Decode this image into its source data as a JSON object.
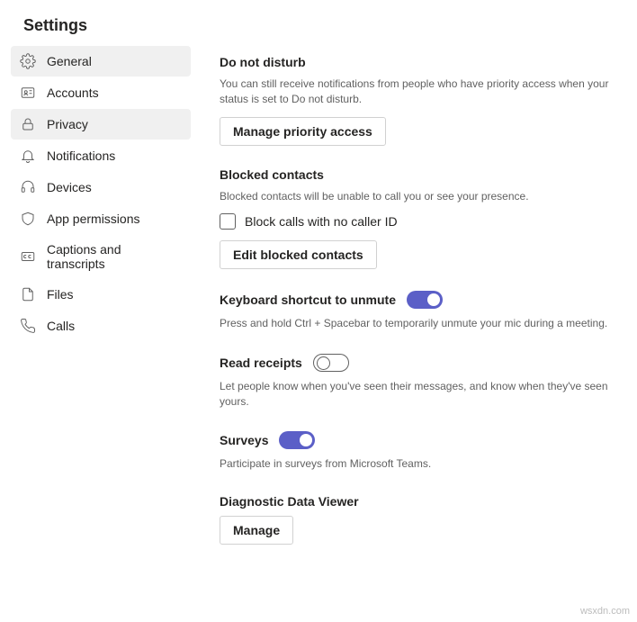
{
  "title": "Settings",
  "sidebar": {
    "items": [
      {
        "label": "General"
      },
      {
        "label": "Accounts"
      },
      {
        "label": "Privacy"
      },
      {
        "label": "Notifications"
      },
      {
        "label": "Devices"
      },
      {
        "label": "App permissions"
      },
      {
        "label": "Captions and transcripts"
      },
      {
        "label": "Files"
      },
      {
        "label": "Calls"
      }
    ],
    "selected": "Privacy"
  },
  "sections": {
    "dnd": {
      "title": "Do not disturb",
      "desc": "You can still receive notifications from people who have priority access when your status is set to Do not disturb.",
      "button": "Manage priority access"
    },
    "blocked": {
      "title": "Blocked contacts",
      "desc": "Blocked contacts will be unable to call you or see your presence.",
      "checkbox_label": "Block calls with no caller ID",
      "checkbox_checked": false,
      "button": "Edit blocked contacts"
    },
    "unmute": {
      "title": "Keyboard shortcut to unmute",
      "toggle": true,
      "desc": "Press and hold Ctrl + Spacebar to temporarily unmute your mic during a meeting."
    },
    "read_receipts": {
      "title": "Read receipts",
      "toggle": false,
      "desc": "Let people know when you've seen their messages, and know when they've seen yours."
    },
    "surveys": {
      "title": "Surveys",
      "toggle": true,
      "desc": "Participate in surveys from Microsoft Teams."
    },
    "diag": {
      "title": "Diagnostic Data Viewer",
      "button": "Manage"
    }
  },
  "watermark": "wsxdn.com"
}
